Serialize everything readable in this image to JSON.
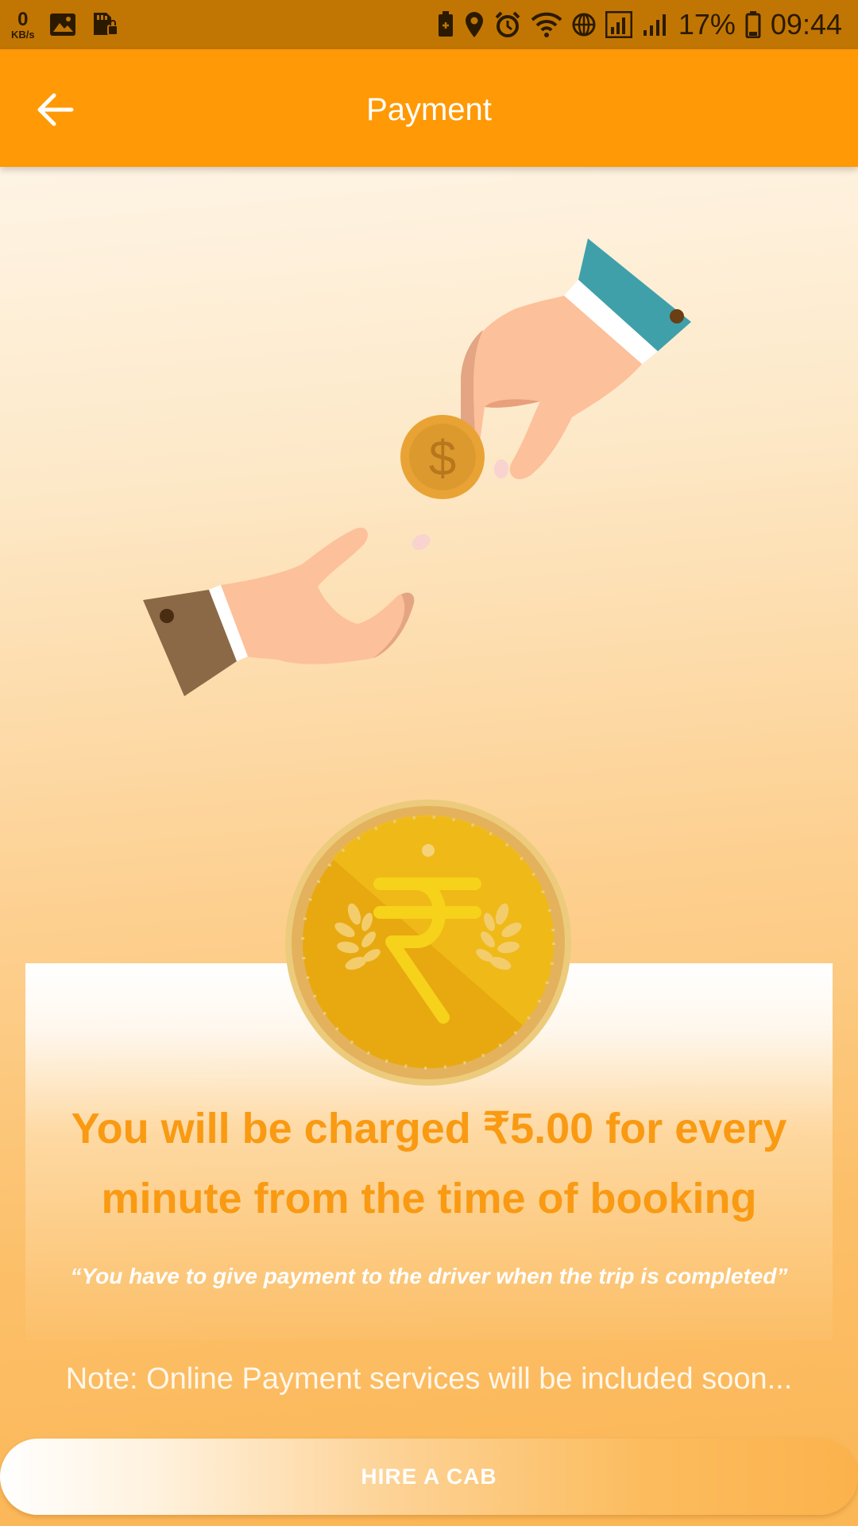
{
  "status_bar": {
    "speed_value": "0",
    "speed_unit": "KB/s",
    "battery_percent": "17%",
    "time": "09:44",
    "icons": [
      "image-icon",
      "sd-card-icon",
      "battery-saver-icon",
      "location-icon",
      "alarm-icon",
      "wifi-icon",
      "vpn-icon",
      "signal-icon",
      "signal-icon",
      "battery-icon"
    ]
  },
  "appbar": {
    "title": "Payment",
    "back_icon": "arrow-left-icon"
  },
  "illustration": {
    "icons": [
      "giving-hand-icon",
      "dollar-coin-icon",
      "receiving-hand-icon",
      "rupee-coin-icon"
    ]
  },
  "info": {
    "title": "You will be charged ₹5.00 for every minute from the time of booking",
    "quote": "“You have to give payment to the driver when the trip is completed”"
  },
  "note": "Note: Online Payment services will be included soon...",
  "hire_button": {
    "label": "HIRE A CAB"
  },
  "colors": {
    "status_bar": "#c17603",
    "app_bar": "#ff9905",
    "accent_text": "#f99a12",
    "coin_gold": "#e7a90f"
  }
}
